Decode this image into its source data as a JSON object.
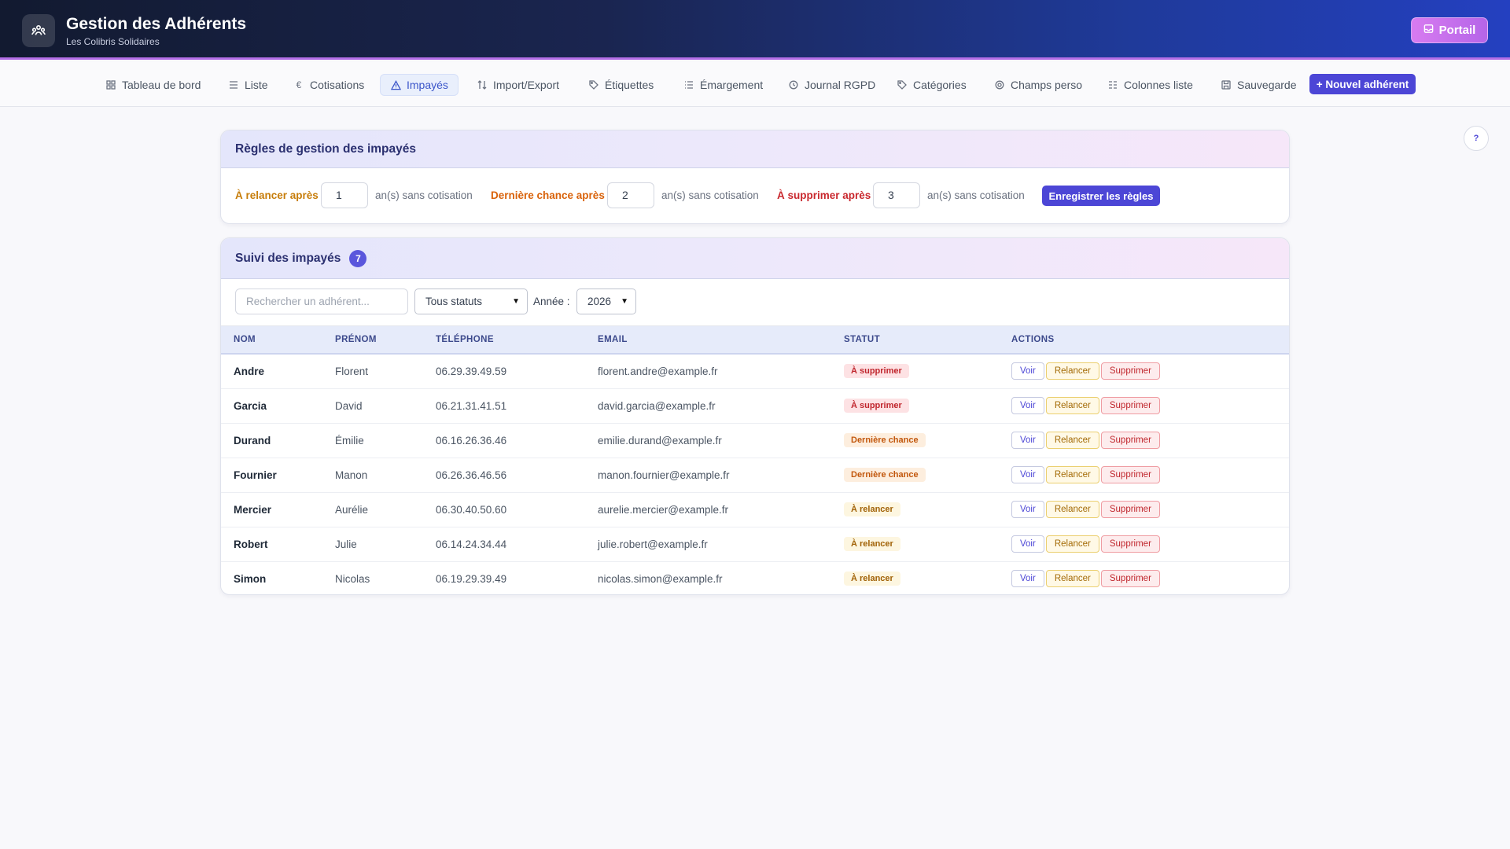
{
  "app": {
    "title": "Gestion des Adhérents",
    "subtitle": "Les Colibris Solidaires",
    "portal_label": "Portail"
  },
  "nav": {
    "items": [
      {
        "label": "Tableau de bord",
        "icon": "grid-icon"
      },
      {
        "label": "Liste",
        "icon": "list-icon"
      },
      {
        "label": "Cotisations",
        "icon": "euro-icon"
      },
      {
        "label": "Impayés",
        "icon": "warning-icon",
        "active": true
      },
      {
        "label": "Import/Export",
        "icon": "transfer-icon"
      },
      {
        "label": "Étiquettes",
        "icon": "tag-icon"
      },
      {
        "label": "Émargement",
        "icon": "list-check-icon"
      },
      {
        "label": "Journal RGPD",
        "icon": "history-icon"
      },
      {
        "label": "Catégories",
        "icon": "tag-icon"
      },
      {
        "label": "Champs perso",
        "icon": "gear-icon"
      },
      {
        "label": "Colonnes liste",
        "icon": "columns-icon"
      },
      {
        "label": "Sauvegarde",
        "icon": "save-icon"
      }
    ],
    "new_member_label": "+ Nouvel adhérent"
  },
  "help_label": "?",
  "rules": {
    "title": "Règles de gestion des impayés",
    "remind_label": "À relancer après",
    "remind_value": "1",
    "last_chance_label": "Dernière chance après",
    "last_chance_value": "2",
    "delete_label": "À supprimer après",
    "delete_value": "3",
    "suffix": "an(s) sans cotisation",
    "save_label": "Enregistrer les règles"
  },
  "tracking": {
    "title": "Suivi des impayés",
    "count": "7",
    "search_placeholder": "Rechercher un adhérent...",
    "status_filter": "Tous statuts",
    "year_label": "Année :",
    "year_value": "2026",
    "columns": [
      "NOM",
      "PRÉNOM",
      "TÉLÉPHONE",
      "EMAIL",
      "STATUT",
      "ACTIONS"
    ],
    "action_labels": {
      "view": "Voir",
      "remind": "Relancer",
      "delete": "Supprimer"
    },
    "rows": [
      {
        "nom": "Andre",
        "prenom": "Florent",
        "tel": "06.29.39.49.59",
        "email": "florent.andre@example.fr",
        "statut": "À supprimer",
        "kind": "del"
      },
      {
        "nom": "Garcia",
        "prenom": "David",
        "tel": "06.21.31.41.51",
        "email": "david.garcia@example.fr",
        "statut": "À supprimer",
        "kind": "del"
      },
      {
        "nom": "Durand",
        "prenom": "Émilie",
        "tel": "06.16.26.36.46",
        "email": "emilie.durand@example.fr",
        "statut": "Dernière chance",
        "kind": "last"
      },
      {
        "nom": "Fournier",
        "prenom": "Manon",
        "tel": "06.26.36.46.56",
        "email": "manon.fournier@example.fr",
        "statut": "Dernière chance",
        "kind": "last"
      },
      {
        "nom": "Mercier",
        "prenom": "Aurélie",
        "tel": "06.30.40.50.60",
        "email": "aurelie.mercier@example.fr",
        "statut": "À relancer",
        "kind": "rel"
      },
      {
        "nom": "Robert",
        "prenom": "Julie",
        "tel": "06.14.24.34.44",
        "email": "julie.robert@example.fr",
        "statut": "À relancer",
        "kind": "rel"
      },
      {
        "nom": "Simon",
        "prenom": "Nicolas",
        "tel": "06.19.29.39.49",
        "email": "nicolas.simon@example.fr",
        "statut": "À relancer",
        "kind": "rel"
      }
    ]
  }
}
